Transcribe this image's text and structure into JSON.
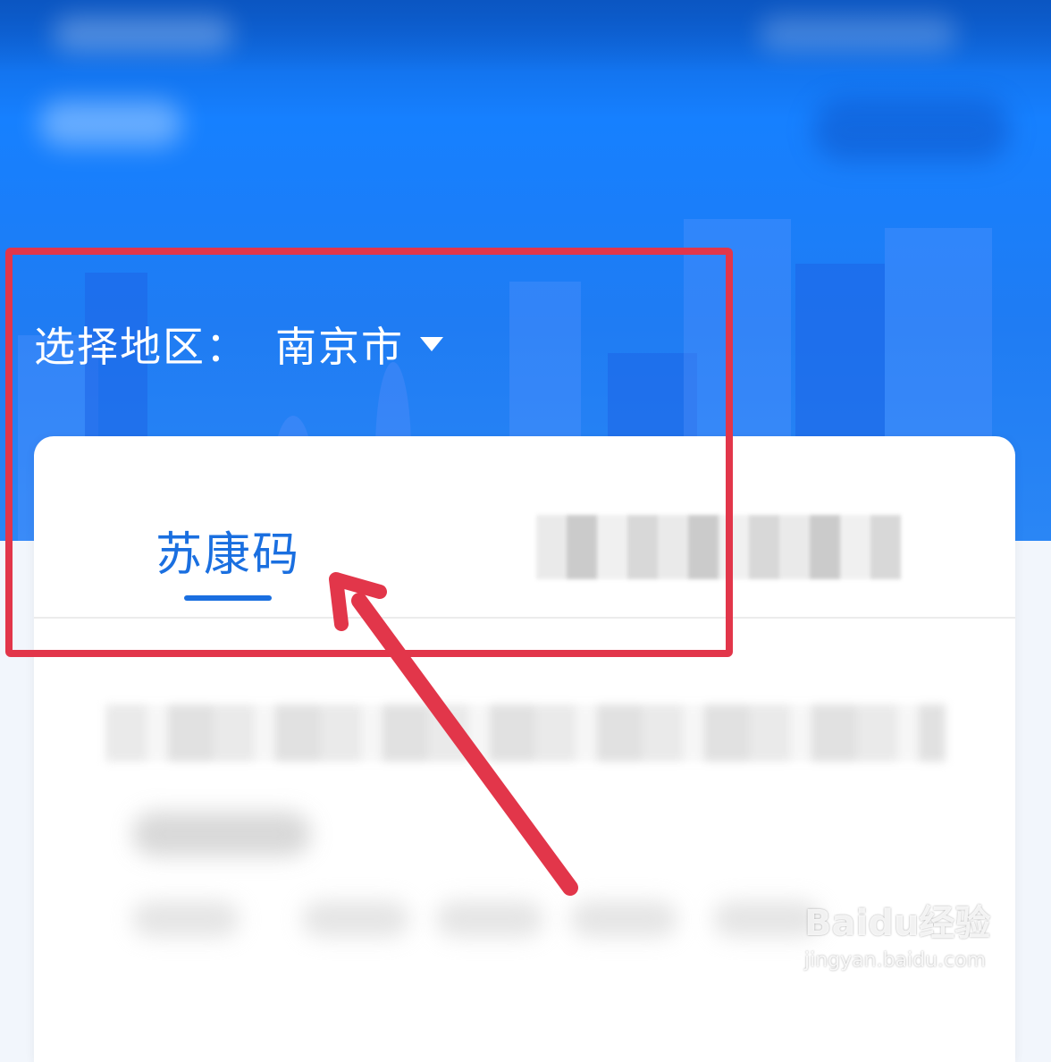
{
  "region": {
    "label": "选择地区：",
    "value": "南京市"
  },
  "tabs": [
    {
      "label": "苏康码",
      "active": true
    }
  ],
  "watermark": {
    "brand": "Baidu经验",
    "url": "jingyan.baidu.com"
  },
  "colors": {
    "primary": "#1a6fe0",
    "annotation": "#e2364a",
    "hero": "#1680ff"
  },
  "icons": {
    "region_dropdown": "caret-down-icon",
    "annotation": "arrow-annotation-icon"
  }
}
